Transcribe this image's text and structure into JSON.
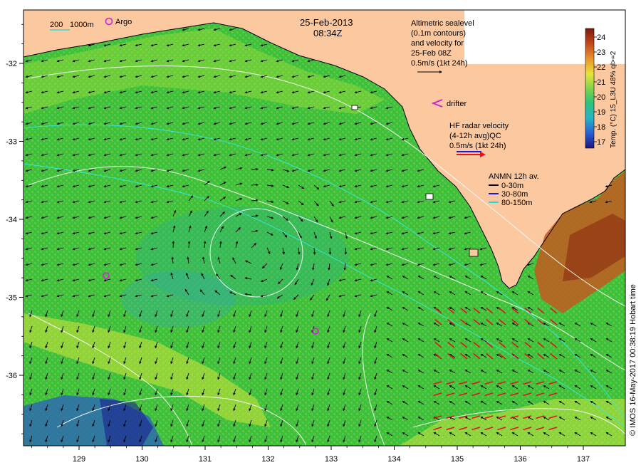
{
  "map": {
    "date": "25-Feb-2013",
    "time": "08:34Z",
    "scale_bar": {
      "depth_short": "200",
      "depth_long": "1000m"
    },
    "argo_label": "Argo",
    "altimetry_lines": [
      "Altimetric sealevel",
      "(0.1m contours)",
      "and velocity for",
      "25-Feb 08Z",
      "0.5m/s (1kt 24h)"
    ],
    "drifter_label": "drifter",
    "hf_radar_lines": [
      "HF radar velocity",
      "(4-12h avg)QC",
      "0.5m/s (1kt 24h)"
    ],
    "anmn": {
      "title": "ANMN 12h av.",
      "bands": [
        "0-30m",
        "30-80m",
        "80-150m"
      ]
    },
    "colorbar": {
      "ticks": [
        "24",
        "23",
        "22",
        "21",
        "20",
        "19",
        "18",
        "17"
      ],
      "label": "Temp. (°C) 15_L3U 48% ql>=2"
    },
    "x_ticks": [
      "129",
      "130",
      "131",
      "132",
      "133",
      "134",
      "135",
      "136",
      "137"
    ],
    "y_ticks": [
      "-32",
      "-33",
      "-34",
      "-35",
      "-36"
    ],
    "credit": "© IMOS 16-May-2017 00:38:19 Hobart time"
  }
}
